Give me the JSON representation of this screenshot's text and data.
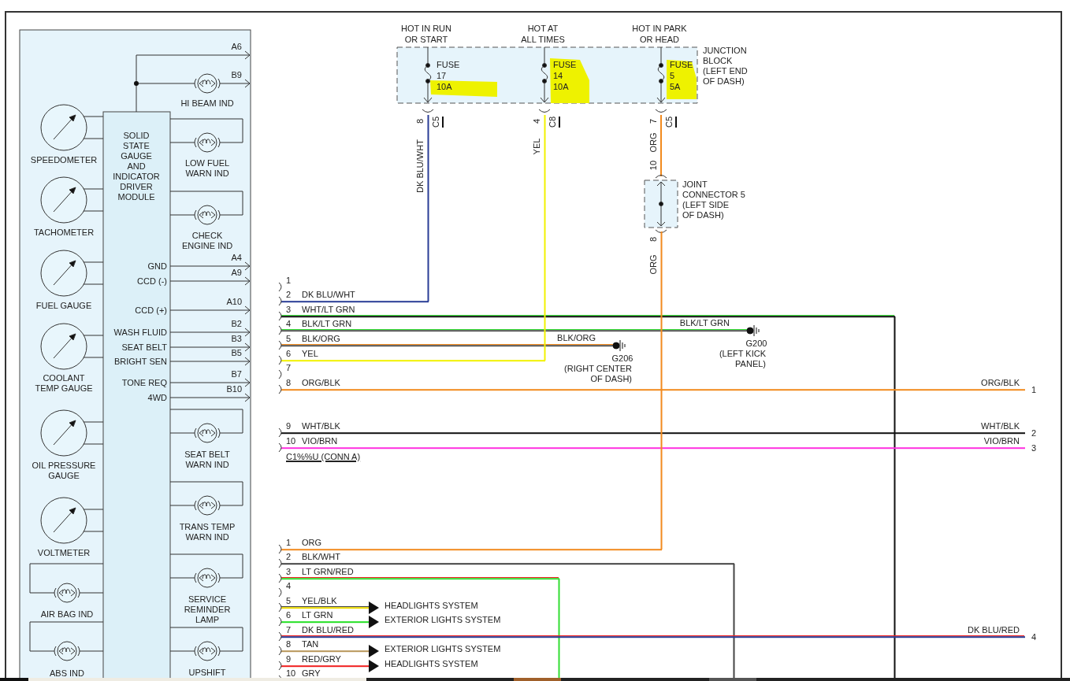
{
  "cluster": {
    "module": "SOLID\nSTATE\nGAUGE\nAND\nINDICATOR\nDRIVER\nMODULE",
    "top_pin": "A6",
    "gauges": [
      {
        "label": "SPEEDOMETER"
      },
      {
        "label": "TACHOMETER"
      },
      {
        "label": "FUEL GAUGE"
      },
      {
        "label": "COOLANT\nTEMP GAUGE"
      },
      {
        "label": "OIL PRESSURE\nGAUGE"
      },
      {
        "label": "VOLTMETER"
      }
    ],
    "left_lamps": [
      {
        "label": "AIR BAG IND"
      },
      {
        "label": "ABS IND"
      }
    ],
    "lamps": [
      {
        "label": "HI BEAM IND",
        "kind": "output",
        "pin": "B9"
      },
      {
        "label": "LOW FUEL\nWARN IND",
        "kind": "loop"
      },
      {
        "label": "CHECK\nENGINE IND",
        "kind": "loop"
      },
      {
        "label": "SEAT BELT\nWARN IND",
        "kind": "loop"
      },
      {
        "label": "TRANS TEMP\nWARN IND",
        "kind": "loop"
      },
      {
        "label": "SERVICE\nREMINDER\nLAMP",
        "kind": "loop"
      },
      {
        "label": "UPSHIFT",
        "kind": "loop"
      }
    ],
    "outputs": [
      {
        "label": "GND",
        "pin": "A4"
      },
      {
        "label": "CCD (-)",
        "pin": "A9"
      },
      {
        "label": "CCD (+)",
        "pin": "A10"
      },
      {
        "label": "WASH FLUID",
        "pin": "B2"
      },
      {
        "label": "SEAT BELT",
        "pin": "B3"
      },
      {
        "label": "BRIGHT SEN",
        "pin": "B5"
      },
      {
        "label": "TONE REQ",
        "pin": "B7"
      },
      {
        "label": "4WD",
        "pin": "B10"
      }
    ]
  },
  "junction_block": {
    "title": "JUNCTION\nBLOCK\n(LEFT END\nOF DASH)",
    "fuses": [
      {
        "supply": "HOT IN RUN\nOR START",
        "label": "FUSE",
        "number": "17",
        "rating": "10A",
        "highlighted": true,
        "pin": "8",
        "connector": "C5",
        "wire": "DK BLU/WHT"
      },
      {
        "supply": "HOT AT\nALL TIMES",
        "label": "FUSE",
        "number": "14",
        "rating": "10A",
        "highlighted": true,
        "pin": "4",
        "connector": "C8",
        "wire": "YEL"
      },
      {
        "supply": "HOT IN PARK\nOR HEAD",
        "label": "FUSE",
        "number": "5",
        "rating": "5A",
        "highlighted": true,
        "pin": "7",
        "connector": "C5",
        "wire": "ORG"
      }
    ]
  },
  "joint_connector": {
    "title": "JOINT\nCONNECTOR 5\n(LEFT SIDE\nOF DASH)",
    "pin_in": "10",
    "pin_out": "8",
    "wire_out": "ORG"
  },
  "connector_a": {
    "label": "C1%%U (CONN A)",
    "pins": [
      {
        "number": "1",
        "kind": "none"
      },
      {
        "number": "2",
        "wire": "DK BLU/WHT",
        "color": "#2a3d96",
        "kind": "feed"
      },
      {
        "number": "3",
        "wire": "WHT/LT GRN",
        "color": "#111111",
        "stripe": {
          "color": "#33dd33"
        },
        "kind": "drop"
      },
      {
        "number": "4",
        "wire": "BLK/LT GRN",
        "color": "#555555",
        "stripe": {
          "color": "#33dd33"
        },
        "kind": "ground",
        "end_label": "BLK/LT GRN",
        "ground": "G200",
        "location": "(LEFT KICK\nPANEL)"
      },
      {
        "number": "5",
        "wire": "BLK/ORG",
        "color": "#555555",
        "stripe": {
          "color": "#f28a1e"
        },
        "kind": "ground",
        "end_label": "BLK/ORG",
        "ground": "G206",
        "location": "(RIGHT CENTER\nOF DASH)"
      },
      {
        "number": "6",
        "wire": "YEL",
        "color": "#f2f200",
        "kind": "feed"
      },
      {
        "number": "7",
        "kind": "none"
      },
      {
        "number": "8",
        "wire": "ORG/BLK",
        "color": "#f28a1e",
        "kind": "through",
        "end_label": "ORG/BLK",
        "end_pin": "1"
      },
      {
        "number": "9",
        "wire": "WHT/BLK",
        "color": "#111111",
        "kind": "through",
        "end_label": "WHT/BLK",
        "end_pin": "2"
      },
      {
        "number": "10",
        "wire": "VIO/BRN",
        "color": "#ff30e0",
        "kind": "through",
        "end_label": "VIO/BRN",
        "end_pin": "3"
      }
    ]
  },
  "connector_b": {
    "pins": [
      {
        "number": "1",
        "wire": "ORG",
        "color": "#f28a1e",
        "kind": "feed"
      },
      {
        "number": "2",
        "wire": "BLK/WHT",
        "color": "#444444",
        "kind": "drop"
      },
      {
        "number": "3",
        "wire": "LT GRN/RED",
        "color": "#33dd33",
        "stripe": {
          "color": "#f02020"
        },
        "kind": "drop"
      },
      {
        "number": "4",
        "kind": "none"
      },
      {
        "number": "5",
        "wire": "YEL/BLK",
        "color": "#eedd00",
        "stripe": {
          "color": "#444444"
        },
        "kind": "system",
        "end_label": "HEADLIGHTS SYSTEM"
      },
      {
        "number": "6",
        "wire": "LT GRN",
        "color": "#22e022",
        "kind": "system",
        "end_label": "EXTERIOR LIGHTS SYSTEM"
      },
      {
        "number": "7",
        "wire": "DK BLU/RED",
        "color": "#2a3d96",
        "stripe": {
          "color": "#f02020"
        },
        "kind": "through",
        "end_label": "DK BLU/RED",
        "end_pin": "4"
      },
      {
        "number": "8",
        "wire": "TAN",
        "color": "#b8965a",
        "kind": "system",
        "end_label": "EXTERIOR LIGHTS SYSTEM"
      },
      {
        "number": "9",
        "wire": "RED/GRY",
        "color": "#f02020",
        "kind": "system",
        "end_label": "HEADLIGHTS SYSTEM"
      },
      {
        "number": "10",
        "wire": "GRY",
        "kind": "none"
      }
    ]
  }
}
